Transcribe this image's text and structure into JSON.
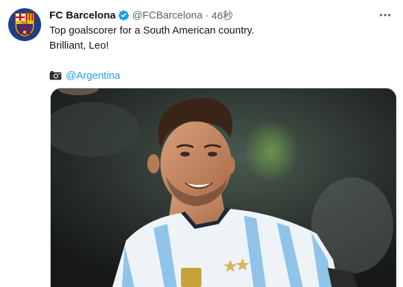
{
  "tweet": {
    "author": {
      "display_name": "FC Barcelona",
      "handle": "@FCBarcelona",
      "verified": true,
      "avatar_icon": "fc-barcelona-crest-icon"
    },
    "separator": "·",
    "timestamp": "46秒",
    "text_lines": [
      "Top goalscorer for a South American country.",
      "Brilliant, Leo!"
    ],
    "credit": {
      "icon": "camera-icon",
      "mention": "@Argentina"
    },
    "media": {
      "type": "photo",
      "subject": "player in Argentina jersey celebrating"
    }
  },
  "colors": {
    "text_primary": "#0f1419",
    "text_secondary": "#536471",
    "link": "#1d9bf0",
    "verified_badge": "#1d9bf0",
    "media_border": "#cfd9de"
  }
}
